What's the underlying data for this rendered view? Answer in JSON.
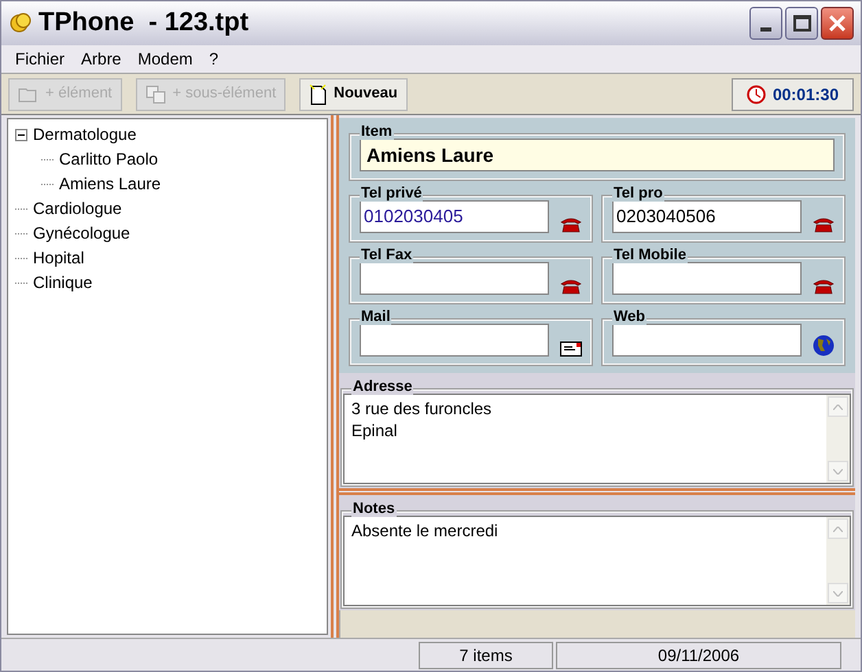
{
  "window": {
    "title": "TPhone  - 123.tpt"
  },
  "menu": [
    "Fichier",
    "Arbre",
    "Modem",
    "?"
  ],
  "toolbar": [
    {
      "label": "+ élément",
      "kind": "folder",
      "disabled": true
    },
    {
      "label": "+ sous-élément",
      "kind": "copy",
      "disabled": true
    },
    {
      "label": "Nouveau",
      "kind": "new",
      "disabled": false
    }
  ],
  "timer": "00:01:30",
  "tree": [
    {
      "label": "Dermatologue",
      "expanded": true,
      "children": [
        {
          "label": "Carlitto Paolo"
        },
        {
          "label": "Amiens Laure"
        }
      ]
    },
    {
      "label": "Cardiologue"
    },
    {
      "label": "Gynécologue"
    },
    {
      "label": "Hopital"
    },
    {
      "label": "Clinique"
    }
  ],
  "item": {
    "label": "Item",
    "value": "Amiens Laure"
  },
  "fields": [
    {
      "label": "Tel privé",
      "value": "0102030405",
      "kind": "phone"
    },
    {
      "label": "Tel pro",
      "value": "0203040506",
      "kind": "phone"
    },
    {
      "label": "Tel Fax",
      "kind": "phone"
    },
    {
      "label": "Tel Mobile",
      "kind": "phone"
    },
    {
      "label": "Mail",
      "kind": "mail"
    },
    {
      "label": "Web",
      "kind": "web"
    }
  ],
  "address": {
    "label": "Adresse",
    "lines": [
      "3 rue des furoncles",
      "Epinal"
    ]
  },
  "notes": {
    "label": "Notes",
    "lines": [
      "Absente le mercredi"
    ]
  },
  "status_bar": {
    "count": "7 items",
    "date": "09/11/2006"
  }
}
